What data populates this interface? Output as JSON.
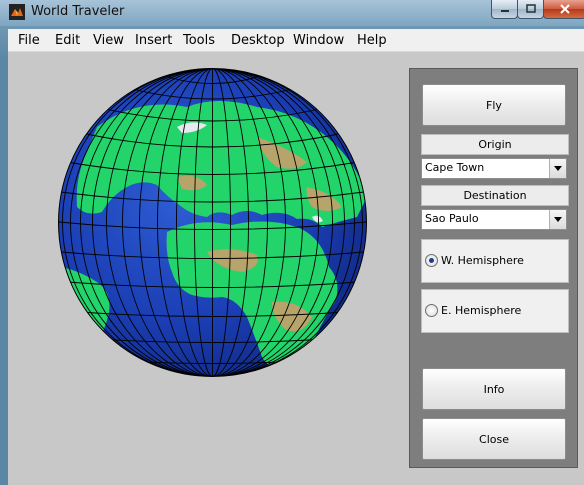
{
  "window": {
    "title": "World Traveler"
  },
  "menu": [
    "File",
    "Edit",
    "View",
    "Insert",
    "Tools",
    "Desktop",
    "Window",
    "Help"
  ],
  "panel": {
    "fly_label": "Fly",
    "origin_label": "Origin",
    "origin_value": "Cape Town",
    "destination_label": "Destination",
    "destination_value": "Sao Paulo",
    "hemisphere_west": "W. Hemisphere",
    "hemisphere_east": "E. Hemisphere",
    "hemisphere_selected": "W. Hemisphere",
    "info_label": "Info",
    "close_label": "Close"
  },
  "colors": {
    "ocean": "#1a3fb0",
    "land": "#22d46a",
    "highlands": "#b6a46b",
    "ice": "#e8e8f0"
  }
}
